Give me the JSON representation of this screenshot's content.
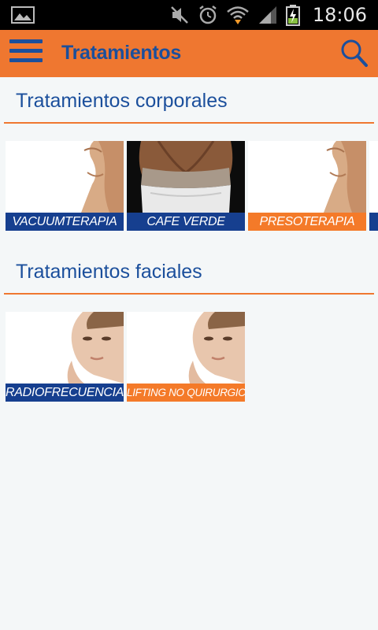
{
  "status_bar": {
    "time": "18:06",
    "icons": [
      "image-icon",
      "mute-icon",
      "alarm-icon",
      "wifi-icon",
      "signal-icon",
      "battery-charging-icon"
    ]
  },
  "app_bar": {
    "title": "Tratamientos",
    "icons": [
      "menu-icon",
      "search-icon"
    ],
    "color": "#ef7730",
    "text_color": "#1b4f9c"
  },
  "sections": [
    {
      "title": "Tratamientos corporales",
      "items": [
        {
          "label": "VACUUMTERAPIA",
          "label_color": "#163f8f"
        },
        {
          "label": "CAFE VERDE",
          "label_color": "#163f8f"
        },
        {
          "label": "PRESOTERAPIA",
          "label_color": "#f47a29"
        }
      ]
    },
    {
      "title": "Tratamientos faciales",
      "items": [
        {
          "label": "RADIOFRECUENCIA",
          "label_color": "#163f8f"
        },
        {
          "label": "LIFTING NO QUIRURGICO",
          "label_color": "#f47a29"
        }
      ]
    }
  ]
}
